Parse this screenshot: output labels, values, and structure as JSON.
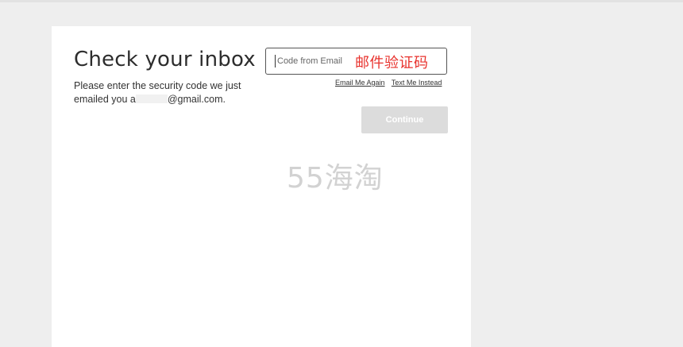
{
  "page": {
    "title": "Check your inbox",
    "description_start": "Please enter the security code we just emailed you a",
    "description_end": "@gmail.com."
  },
  "code_input": {
    "placeholder": "Code from Email",
    "annotation": "邮件验证码"
  },
  "links": {
    "email_again": "Email Me Again",
    "text_instead": "Text Me Instead"
  },
  "buttons": {
    "continue": "Continue"
  },
  "watermark": "55海淘",
  "colors": {
    "annotation": "#e8322d",
    "continue_disabled": "#dcdcdc",
    "page_background": "#eeeeee"
  }
}
